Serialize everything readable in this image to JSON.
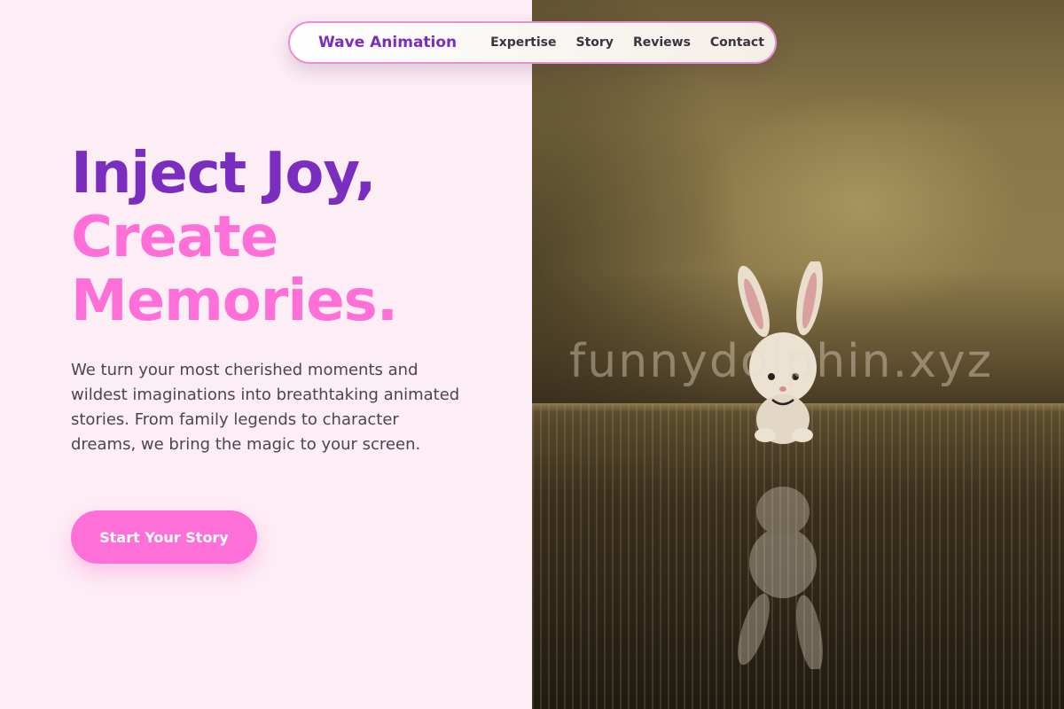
{
  "nav": {
    "brand": "Wave Animation",
    "links": [
      {
        "label": "Expertise"
      },
      {
        "label": "Story"
      },
      {
        "label": "Reviews"
      },
      {
        "label": "Contact"
      }
    ]
  },
  "hero": {
    "headline_line1": "Inject Joy,",
    "headline_line2": "Create",
    "headline_line3": "Memories.",
    "description": "We turn your most cherished moments and wildest imaginations into breathtaking animated stories. From family legends to character dreams, we bring the magic to your screen.",
    "cta_label": "Start Your Story"
  },
  "image": {
    "watermark": "funnydolphin.xyz",
    "subject": "bunny-figurine"
  },
  "colors": {
    "brand_purple": "#7b2dbf",
    "accent_pink": "#ff6fd8",
    "background": "#fdedf5"
  }
}
